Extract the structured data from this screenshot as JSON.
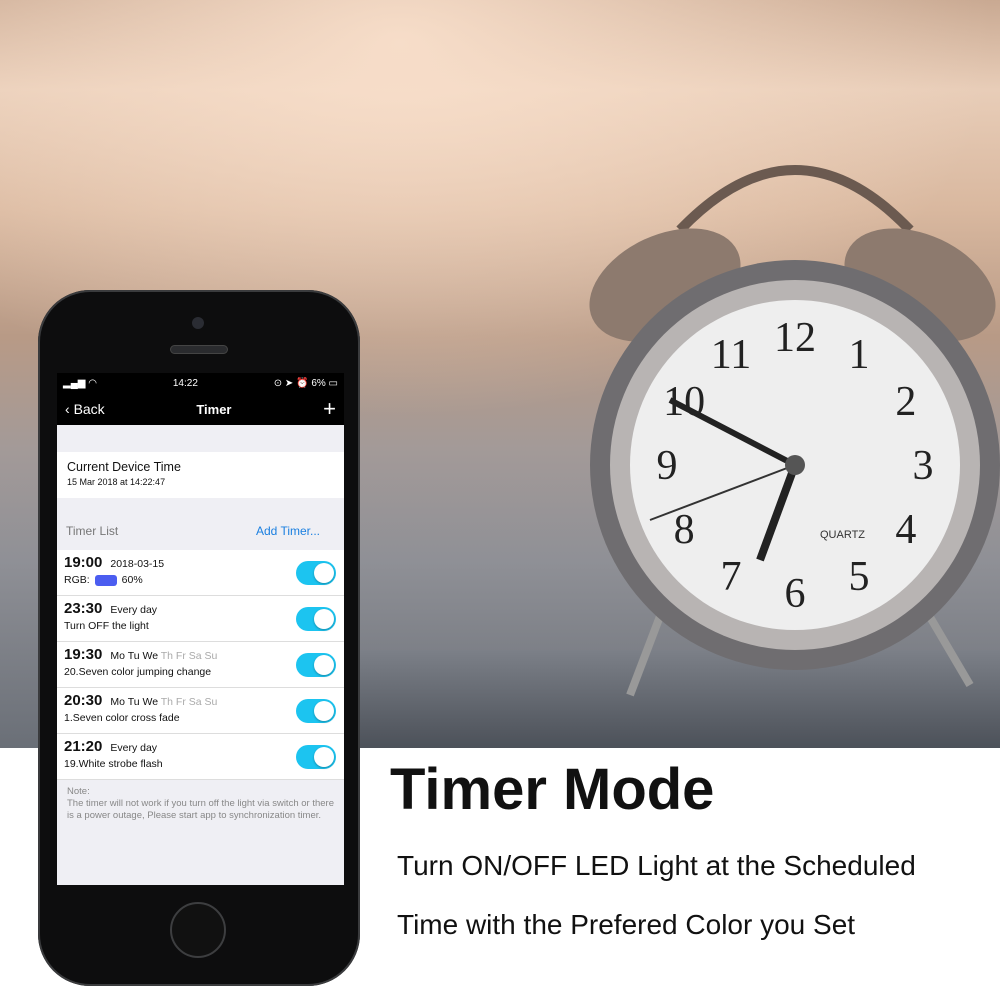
{
  "status_bar": {
    "time": "14:22",
    "battery": "6%"
  },
  "nav": {
    "back_label": "Back",
    "title": "Timer",
    "add_icon": "plus-icon"
  },
  "device_time": {
    "label": "Current Device Time",
    "value": "15 Mar 2018 at 14:22:47"
  },
  "timer_list": {
    "header": "Timer List",
    "add_label": "Add Timer...",
    "items": [
      {
        "time": "19:00",
        "days_on": "2018-03-15",
        "days_off": "",
        "rgb_label": "RGB:",
        "rgb_color": "#4b5df0",
        "detail": "60%",
        "enabled": true
      },
      {
        "time": "23:30",
        "days_on": "Every day",
        "days_off": "",
        "detail": "Turn OFF the light",
        "enabled": true
      },
      {
        "time": "19:30",
        "days_on": "Mo Tu We",
        "days_off": "Th Fr Sa Su",
        "detail": "20.Seven color jumping change",
        "enabled": true
      },
      {
        "time": "20:30",
        "days_on": "Mo Tu We",
        "days_off": "Th Fr Sa Su",
        "detail": "1.Seven color cross fade",
        "enabled": true
      },
      {
        "time": "21:20",
        "days_on": "Every day",
        "days_off": "",
        "detail": "19.White strobe flash",
        "enabled": true
      }
    ]
  },
  "note": {
    "title": "Note:",
    "text": "The timer will not work if you turn off the light via switch or there is a power outage, Please start app to synchronization timer."
  },
  "headline": "Timer Mode",
  "subtitle_lines": [
    "Turn ON/OFF LED Light at the Scheduled",
    "Time with the Prefered Color you Set"
  ],
  "clock": {
    "brand": "QUARTZ"
  },
  "colors": {
    "toggle": "#1cc4f0",
    "link": "#1a7fe0"
  }
}
